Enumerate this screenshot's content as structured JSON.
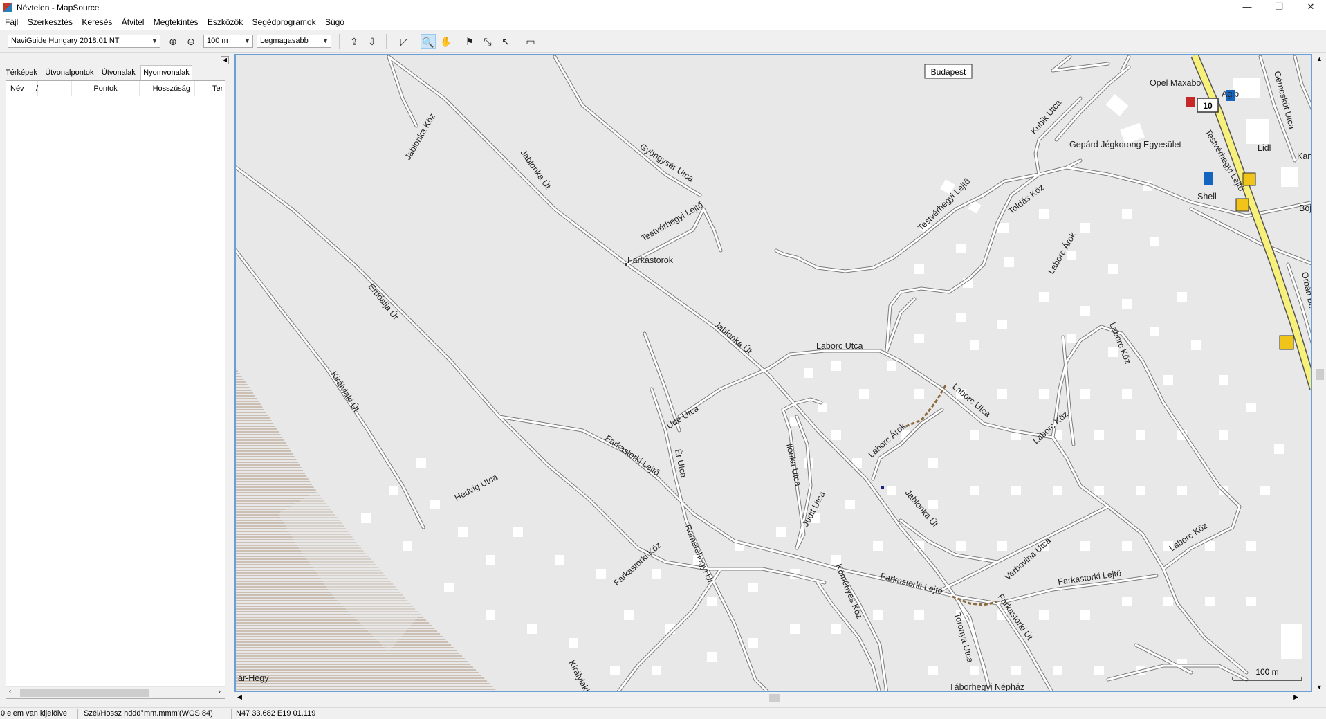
{
  "window": {
    "title": "Névtelen - MapSource",
    "minimize": "—",
    "maximize": "❐",
    "close": "✕"
  },
  "menu": [
    "Fájl",
    "Szerkesztés",
    "Keresés",
    "Átvitel",
    "Megtekintés",
    "Eszközök",
    "Segédprogramok",
    "Súgó"
  ],
  "toolbar": {
    "map_product": "NaviGuide Hungary 2018.01 NT",
    "zoom_level": "100 m",
    "detail_level": "Legmagasabb"
  },
  "left_panel": {
    "tabs": [
      "Térképek",
      "Útvonalpontok",
      "Útvonalak",
      "Nyomvonalak"
    ],
    "selected_tab": "Nyomvonalak",
    "columns": [
      "Név",
      "/",
      "Pontok",
      "Hosszúság",
      "Ter"
    ]
  },
  "map": {
    "city_label": "Budapest",
    "route_shield": "10",
    "scale_label": "100 m",
    "labels": {
      "jablonka_koz": "Jablonka Köz",
      "jablonka_ut_top": "Jablonka Út",
      "gooncser": "Gyöngysér Utca",
      "testverhegyi_lejto_a": "Testvérhegyi Lejtő",
      "farkastorok": "Farkastorok",
      "erdoalja": "Erdőalja Út",
      "kiralylaki": "Királylaki Út",
      "hedvig": "Hedvig Utca",
      "jablonka_ut_mid": "Jablonka Út",
      "laborc_utca_top": "Laborc Utca",
      "ude_utca": "Üde Utca",
      "er_utca": "Ér Utca",
      "farkastorki_lejto_a": "Farkastorki Lejtő",
      "farkastorki_koz": "Farkastorki Köz",
      "remetehegyi": "Remetehegyi Út",
      "ilonka": "Ilonka Utca",
      "judit": "Judit Utca",
      "laborc_arok_a": "Laborc Árok",
      "laborc_utca_b": "Laborc Utca",
      "jablonka_ut_low": "Jablonka Út",
      "komyves": "Köményes Köz",
      "farkastorki_lejto_b": "Farkastorki Lejtő",
      "toronya": "Toronya Utca",
      "farkastorki_ut": "Farkastorki Út",
      "verbovina": "Verbovina Utca",
      "farkastorki_lejto_c": "Farkastorki Lejtő",
      "laborc_koz_a": "Laborc Köz",
      "laborc_koz_b": "Laborc Köz",
      "laborc_koz_c": "Laborc Köz",
      "laborc_arok_b": "Laborc Árok",
      "toldas": "Toldás Köz",
      "testverhegyi_lejto_b": "Testvérhegyi Lejtő",
      "kubik": "Kubik Utca",
      "opel": "Opel Maxabo",
      "agip": "Agip",
      "gepard": "Gepárd Jégkorong Egyesület",
      "lidl": "Lidl",
      "shell": "Shell",
      "gemeskut": "Gémeskút Utca",
      "testverhegyi_lejto_c": "Testvérhegyi Lejtő",
      "kana": "Kana",
      "boj": "Boj",
      "orban": "Orbán Bé",
      "tabor": "Táborhegyi Népház",
      "arhegy": "ár-Hegy",
      "kiralylaki_b": "Királylaki"
    }
  },
  "status": {
    "selection": "0 elem van kijelölve",
    "coord_format": "Szél/Hossz hddd°mm.mmm'(WGS 84)",
    "coordinates": "N47 33.682 E19 01.119"
  }
}
